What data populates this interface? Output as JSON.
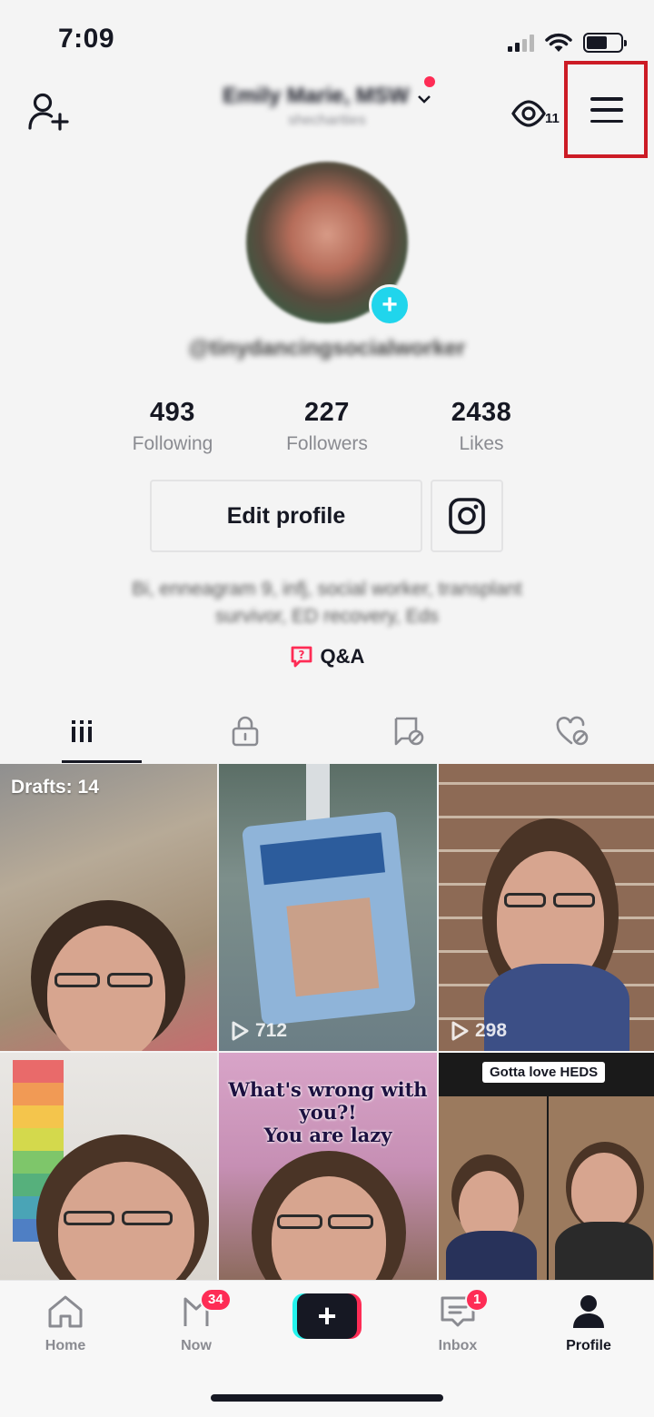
{
  "status_bar": {
    "time": "7:09"
  },
  "header": {
    "title": "Emily Marie, MSW",
    "subtitle": "shecharities",
    "views_count": "11"
  },
  "profile": {
    "handle": "@tinydancingsocialworker",
    "stats": [
      {
        "value": "493",
        "label": "Following"
      },
      {
        "value": "227",
        "label": "Followers"
      },
      {
        "value": "2438",
        "label": "Likes"
      }
    ],
    "edit_button": "Edit profile",
    "bio_line1": "Bi, enneagram 9, infj, social worker, transplant",
    "bio_line2": "survivor, ED recovery, Eds",
    "qa_label": "Q&A"
  },
  "tabs": [
    "videos-grid-icon",
    "private-lock-icon",
    "reposts-icon",
    "liked-icon"
  ],
  "grid": {
    "drafts_label": "Drafts: 14",
    "views": [
      "712",
      "298"
    ],
    "overlay_line1": "What's wrong with you?!",
    "overlay_line2": "You are lazy",
    "caption_tag": "Gotta love HEDS"
  },
  "bottom_nav": {
    "home": "Home",
    "now": "Now",
    "now_badge": "34",
    "inbox": "Inbox",
    "inbox_badge": "1",
    "profile": "Profile"
  },
  "colors": {
    "accent": "#fe2c55",
    "teal": "#25f4ee",
    "highlight_box": "#cc1b25"
  }
}
